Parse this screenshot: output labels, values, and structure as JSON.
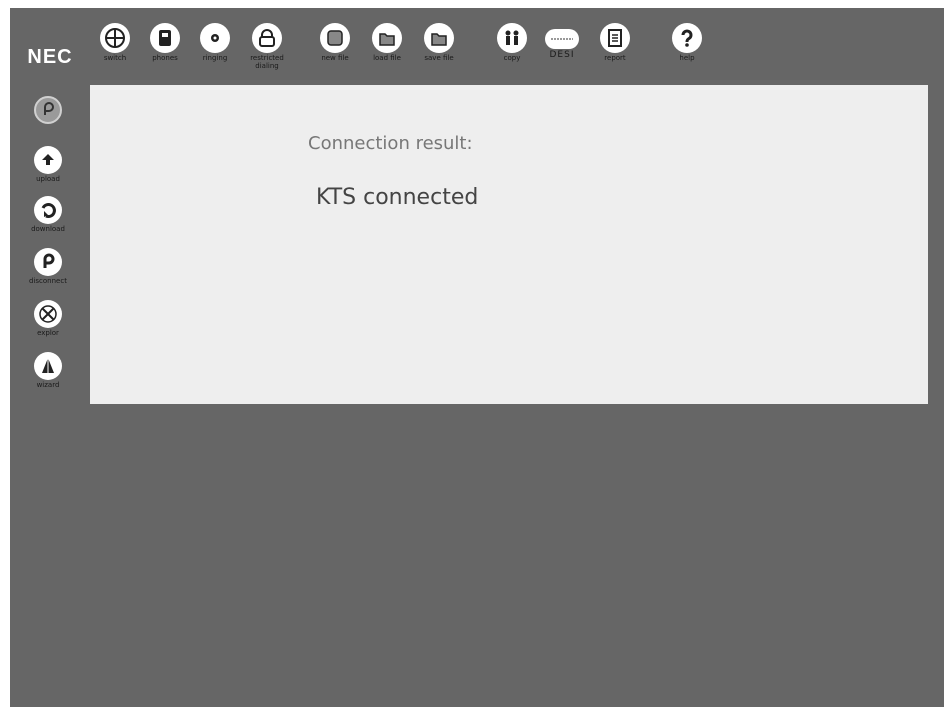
{
  "brand": {
    "logo": "NEC"
  },
  "toolbar": [
    {
      "key": "switch",
      "label": "switch",
      "icon": "switch-icon"
    },
    {
      "key": "phones",
      "label": "phones",
      "icon": "phone-icon"
    },
    {
      "key": "ringing",
      "label": "ringing",
      "icon": "ringing-icon"
    },
    {
      "key": "restricted",
      "label": "restricted dialing",
      "icon": "lock-icon"
    },
    {
      "key": "newfile",
      "label": "new file",
      "icon": "new-file-icon"
    },
    {
      "key": "loadfile",
      "label": "load file",
      "icon": "load-file-icon"
    },
    {
      "key": "savefile",
      "label": "save file",
      "icon": "save-file-icon"
    },
    {
      "key": "copy",
      "label": "copy",
      "icon": "copy-icon"
    },
    {
      "key": "desi",
      "label": "DESI",
      "icon": "desi-icon"
    },
    {
      "key": "report",
      "label": "report",
      "icon": "report-icon"
    },
    {
      "key": "help",
      "label": "help",
      "icon": "help-icon"
    }
  ],
  "sidebar": [
    {
      "key": "connect",
      "label": "",
      "icon": "connect-icon"
    },
    {
      "key": "upload",
      "label": "upload",
      "icon": "upload-icon"
    },
    {
      "key": "download",
      "label": "download",
      "icon": "download-icon"
    },
    {
      "key": "disconnect",
      "label": "disconnect",
      "icon": "disconnect-icon"
    },
    {
      "key": "explorer",
      "label": "explor",
      "icon": "explorer-icon"
    },
    {
      "key": "wizard",
      "label": "wizard",
      "icon": "wizard-icon"
    }
  ],
  "panel": {
    "heading": "Connection result:",
    "result": "KTS connected"
  },
  "colors": {
    "background": "#666666",
    "panel": "#eeeeee",
    "icon": "#ffffff",
    "icon_glyph": "#222222"
  }
}
